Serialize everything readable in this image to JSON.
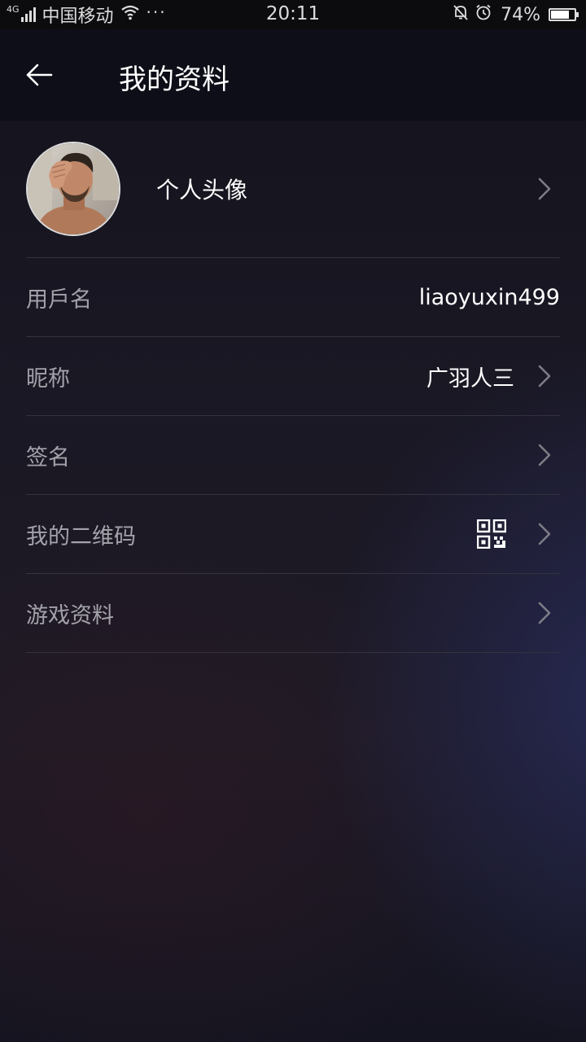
{
  "status_bar": {
    "network": "4G",
    "carrier": "中国移动",
    "dots": "···",
    "time": "20:11",
    "battery": "74%",
    "battery_level": 0.74
  },
  "header": {
    "title": "我的资料"
  },
  "profile": {
    "avatar_label": "个人头像",
    "rows": [
      {
        "label": "用戶名",
        "value": "liaoyuxin499"
      },
      {
        "label": "昵称",
        "value": "广羽人三"
      },
      {
        "label": "签名",
        "value": ""
      },
      {
        "label": "我的二维码",
        "value": ""
      },
      {
        "label": "游戏资料",
        "value": ""
      }
    ]
  },
  "icons": {
    "back": "arrow-left-icon",
    "chevron": "chevron-right-icon",
    "qr": "qr-code-icon"
  }
}
